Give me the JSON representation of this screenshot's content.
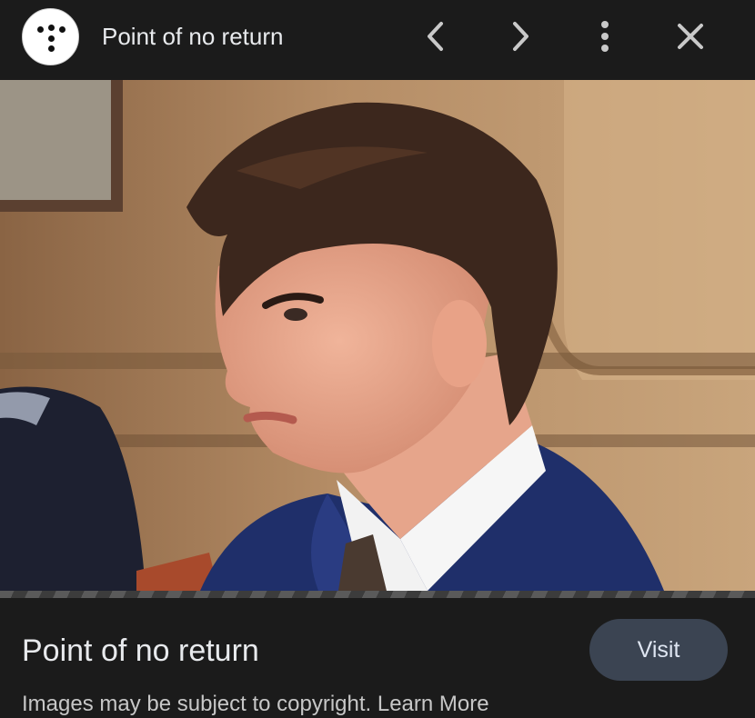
{
  "topbar": {
    "title": "Point of no return",
    "icons": {
      "site": "braille-dots-logo-icon",
      "previous": "chevron-left-icon",
      "next": "chevron-right-icon",
      "more": "more-vert-icon",
      "close": "close-icon"
    }
  },
  "preview": {
    "image_subject": "photo-of-man-in-navy-suit-courtroom"
  },
  "footer": {
    "title": "Point of no return",
    "visit_label": "Visit",
    "subtitle_cut": "Images may be subject to copyright. Learn More"
  },
  "colors": {
    "background": "#1b1b1b",
    "button": "#3b4452",
    "text": "#e8eaed"
  }
}
